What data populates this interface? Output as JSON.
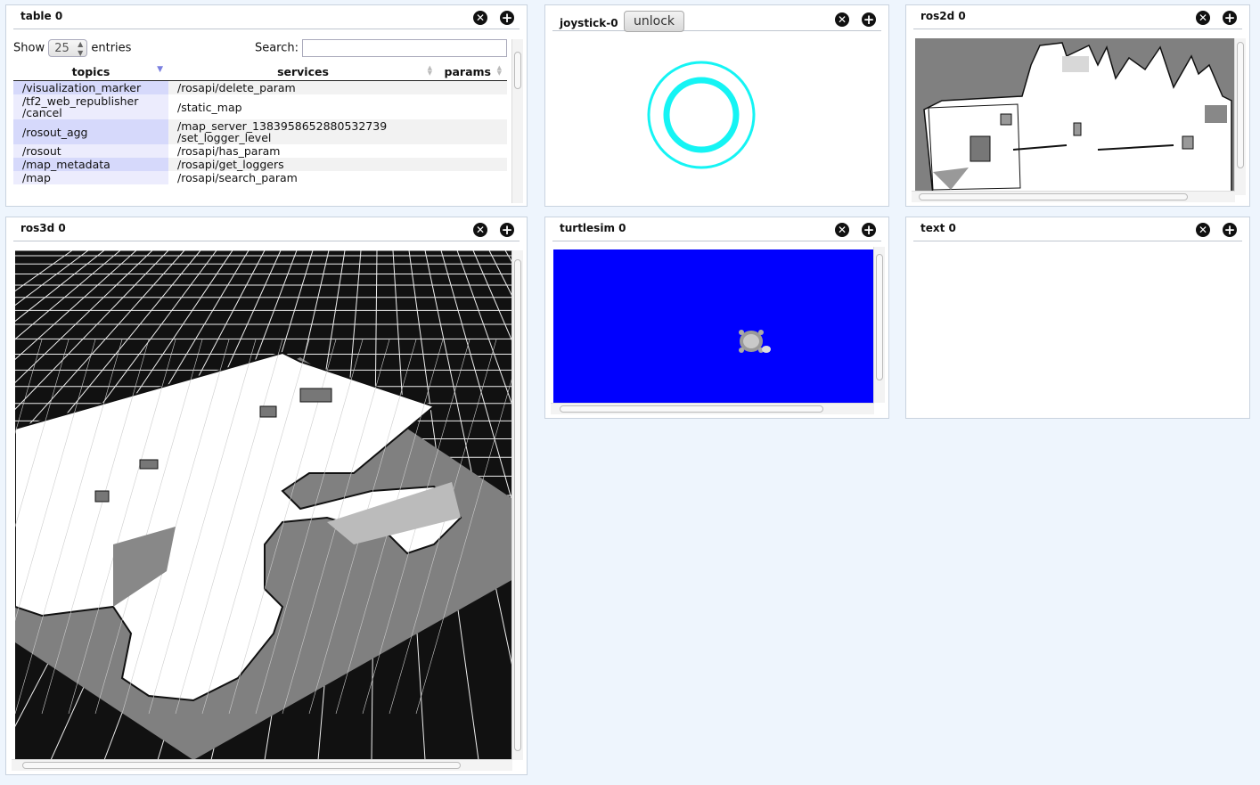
{
  "table_panel": {
    "title": "table 0",
    "show_label": "Show",
    "show_value": "25",
    "entries_label": "entries",
    "search_label": "Search:",
    "search_value": "",
    "columns": [
      "topics",
      "services",
      "params"
    ],
    "rows": [
      {
        "topic": "/visualization_marker",
        "service": "/rosapi/delete_param",
        "param": ""
      },
      {
        "topic": "/tf2_web_republisher\n/cancel",
        "service": "/static_map",
        "param": ""
      },
      {
        "topic": "/rosout_agg",
        "service": "/map_server_1383958652880532739\n/set_logger_level",
        "param": ""
      },
      {
        "topic": "/rosout",
        "service": "/rosapi/has_param",
        "param": ""
      },
      {
        "topic": "/map_metadata",
        "service": "/rosapi/get_loggers",
        "param": ""
      },
      {
        "topic": "/map",
        "service": "/rosapi/search_param",
        "param": ""
      }
    ]
  },
  "joystick_panel": {
    "title": "joystick-0",
    "unlock_label": "unlock",
    "ring_color": "#15f4f4"
  },
  "ros2d_panel": {
    "title": "ros2d 0"
  },
  "ros3d_panel": {
    "title": "ros3d 0"
  },
  "turtlesim_panel": {
    "title": "turtlesim 0",
    "background_color": "#0000ff"
  },
  "text_panel": {
    "title": "text 0"
  },
  "icons": {
    "close": "close-icon",
    "add": "add-icon"
  }
}
